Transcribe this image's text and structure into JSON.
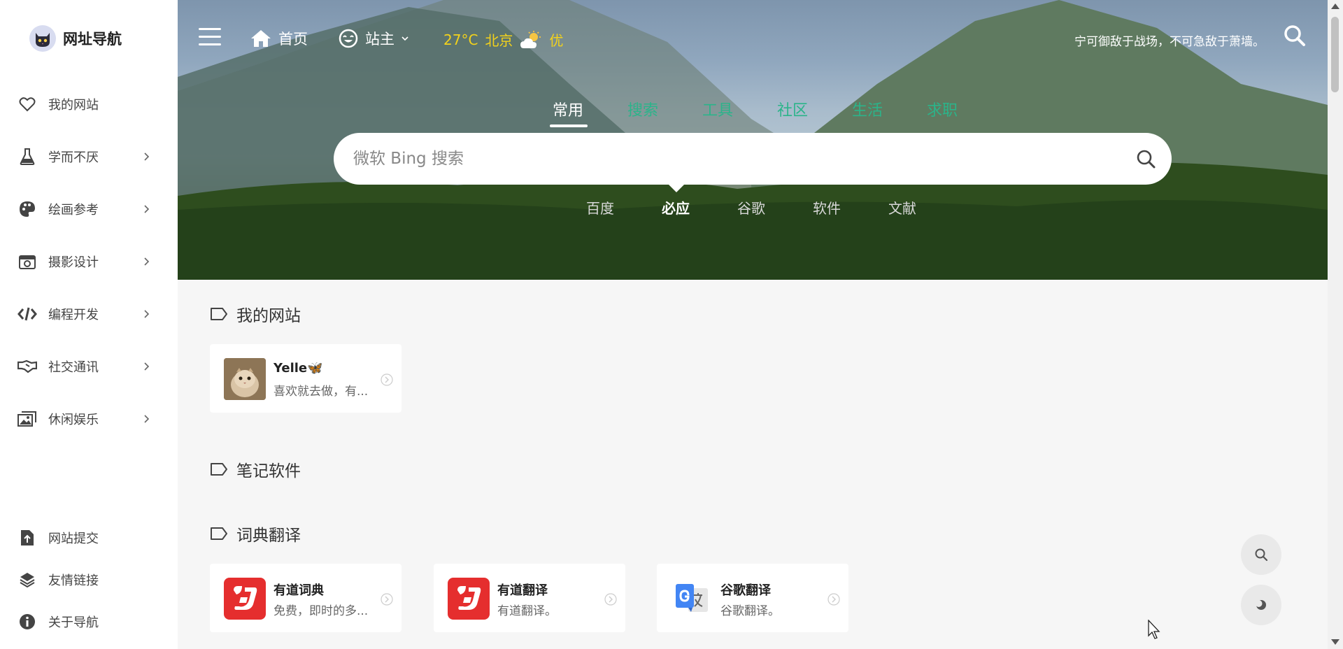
{
  "app": {
    "name": "网址导航"
  },
  "sidebar": {
    "items": [
      {
        "label": "我的网站",
        "icon": "heart-icon",
        "has_arrow": false
      },
      {
        "label": "学而不厌",
        "icon": "flask-icon",
        "has_arrow": true
      },
      {
        "label": "绘画参考",
        "icon": "palette-icon",
        "has_arrow": true
      },
      {
        "label": "摄影设计",
        "icon": "camera-icon",
        "has_arrow": true
      },
      {
        "label": "编程开发",
        "icon": "code-icon",
        "has_arrow": true
      },
      {
        "label": "社交通讯",
        "icon": "handshake-icon",
        "has_arrow": true
      },
      {
        "label": "休闲娱乐",
        "icon": "images-icon",
        "has_arrow": true
      }
    ],
    "footer": [
      {
        "label": "网站提交",
        "icon": "file-upload-icon"
      },
      {
        "label": "友情链接",
        "icon": "link-icon"
      },
      {
        "label": "关于导航",
        "icon": "info-icon"
      }
    ]
  },
  "header": {
    "home_label": "首页",
    "admin_label": "站主",
    "weather": {
      "temp": "27°C",
      "city": "北京",
      "aqi": "优"
    },
    "motto": "宁可御敌于战场，不可急敌于萧墙。"
  },
  "search": {
    "tabs": [
      "常用",
      "搜索",
      "工具",
      "社区",
      "生活",
      "求职"
    ],
    "active_tab": "常用",
    "placeholder": "微软 Bing 搜索",
    "engines": [
      "百度",
      "必应",
      "谷歌",
      "软件",
      "文献"
    ],
    "active_engine": "必应"
  },
  "sections": [
    {
      "title": "我的网站",
      "cards": [
        {
          "title": "Yelle🦋",
          "desc": "喜欢就去做，有...",
          "thumb": "cat-avatar"
        }
      ]
    },
    {
      "title": "笔记软件",
      "cards": []
    },
    {
      "title": "词典翻译",
      "cards": [
        {
          "title": "有道词典",
          "desc": "免费，即时的多...",
          "thumb": "youdao-logo"
        },
        {
          "title": "有道翻译",
          "desc": "有道翻译。",
          "thumb": "youdao-logo"
        },
        {
          "title": "谷歌翻译",
          "desc": "谷歌翻译。",
          "thumb": "google-translate-logo"
        }
      ]
    }
  ],
  "colors": {
    "accent_green": "#2bb48a",
    "weather_yellow": "#f3d21b",
    "youdao_red": "#e52e2e",
    "google_blue": "#4285f4"
  }
}
